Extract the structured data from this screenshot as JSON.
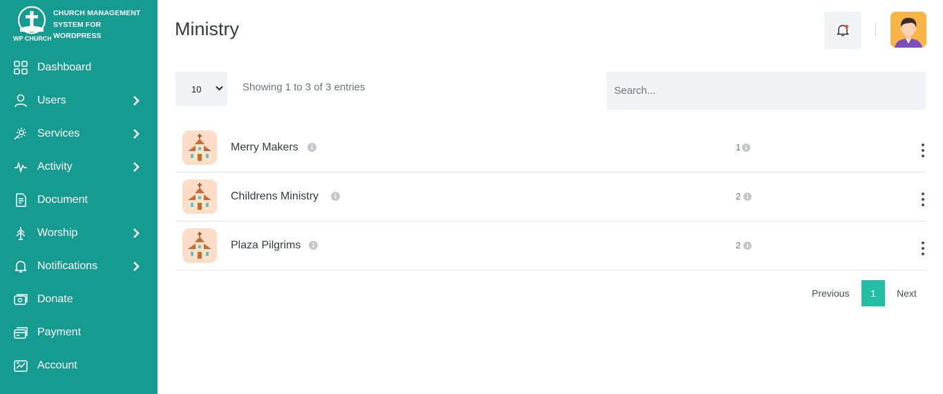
{
  "brand": {
    "logo_caption": "WP CHURCH",
    "line1": "CHURCH MANAGEMENT",
    "line2": "SYSTEM FOR",
    "line3": "WORDPRESS"
  },
  "sidebar": {
    "items": [
      {
        "label": "Dashboard",
        "icon": "grid-icon",
        "has_submenu": false
      },
      {
        "label": "Users",
        "icon": "user-icon",
        "has_submenu": true
      },
      {
        "label": "Services",
        "icon": "services-icon",
        "has_submenu": true
      },
      {
        "label": "Activity",
        "icon": "pulse-icon",
        "has_submenu": true
      },
      {
        "label": "Document",
        "icon": "document-icon",
        "has_submenu": false
      },
      {
        "label": "Worship",
        "icon": "worship-icon",
        "has_submenu": true
      },
      {
        "label": "Notifications",
        "icon": "bell-icon",
        "has_submenu": true
      },
      {
        "label": "Donate",
        "icon": "donate-icon",
        "has_submenu": false
      },
      {
        "label": "Payment",
        "icon": "payment-icon",
        "has_submenu": false
      },
      {
        "label": "Account",
        "icon": "account-icon",
        "has_submenu": false
      }
    ]
  },
  "header": {
    "title": "Ministry",
    "has_unread_notifications": true
  },
  "toolbar": {
    "page_length": "10",
    "page_length_options": [
      "10"
    ],
    "info": "Showing 1 to 3 of 3 entries",
    "search_placeholder": "Search...",
    "search_value": ""
  },
  "rows": [
    {
      "name": "Merry Makers",
      "count": "1"
    },
    {
      "name": "Childrens Ministry",
      "count": "2"
    },
    {
      "name": "Plaza Pilgrims",
      "count": "2"
    }
  ],
  "pagination": {
    "previous": "Previous",
    "current": "1",
    "next": "Next"
  },
  "colors": {
    "sidebar_bg": "#159b8f",
    "accent": "#22bfa5",
    "notification_dot": "#e74c3c",
    "avatar_bg": "#f8b546",
    "row_icon_bg": "#fddcc8"
  }
}
